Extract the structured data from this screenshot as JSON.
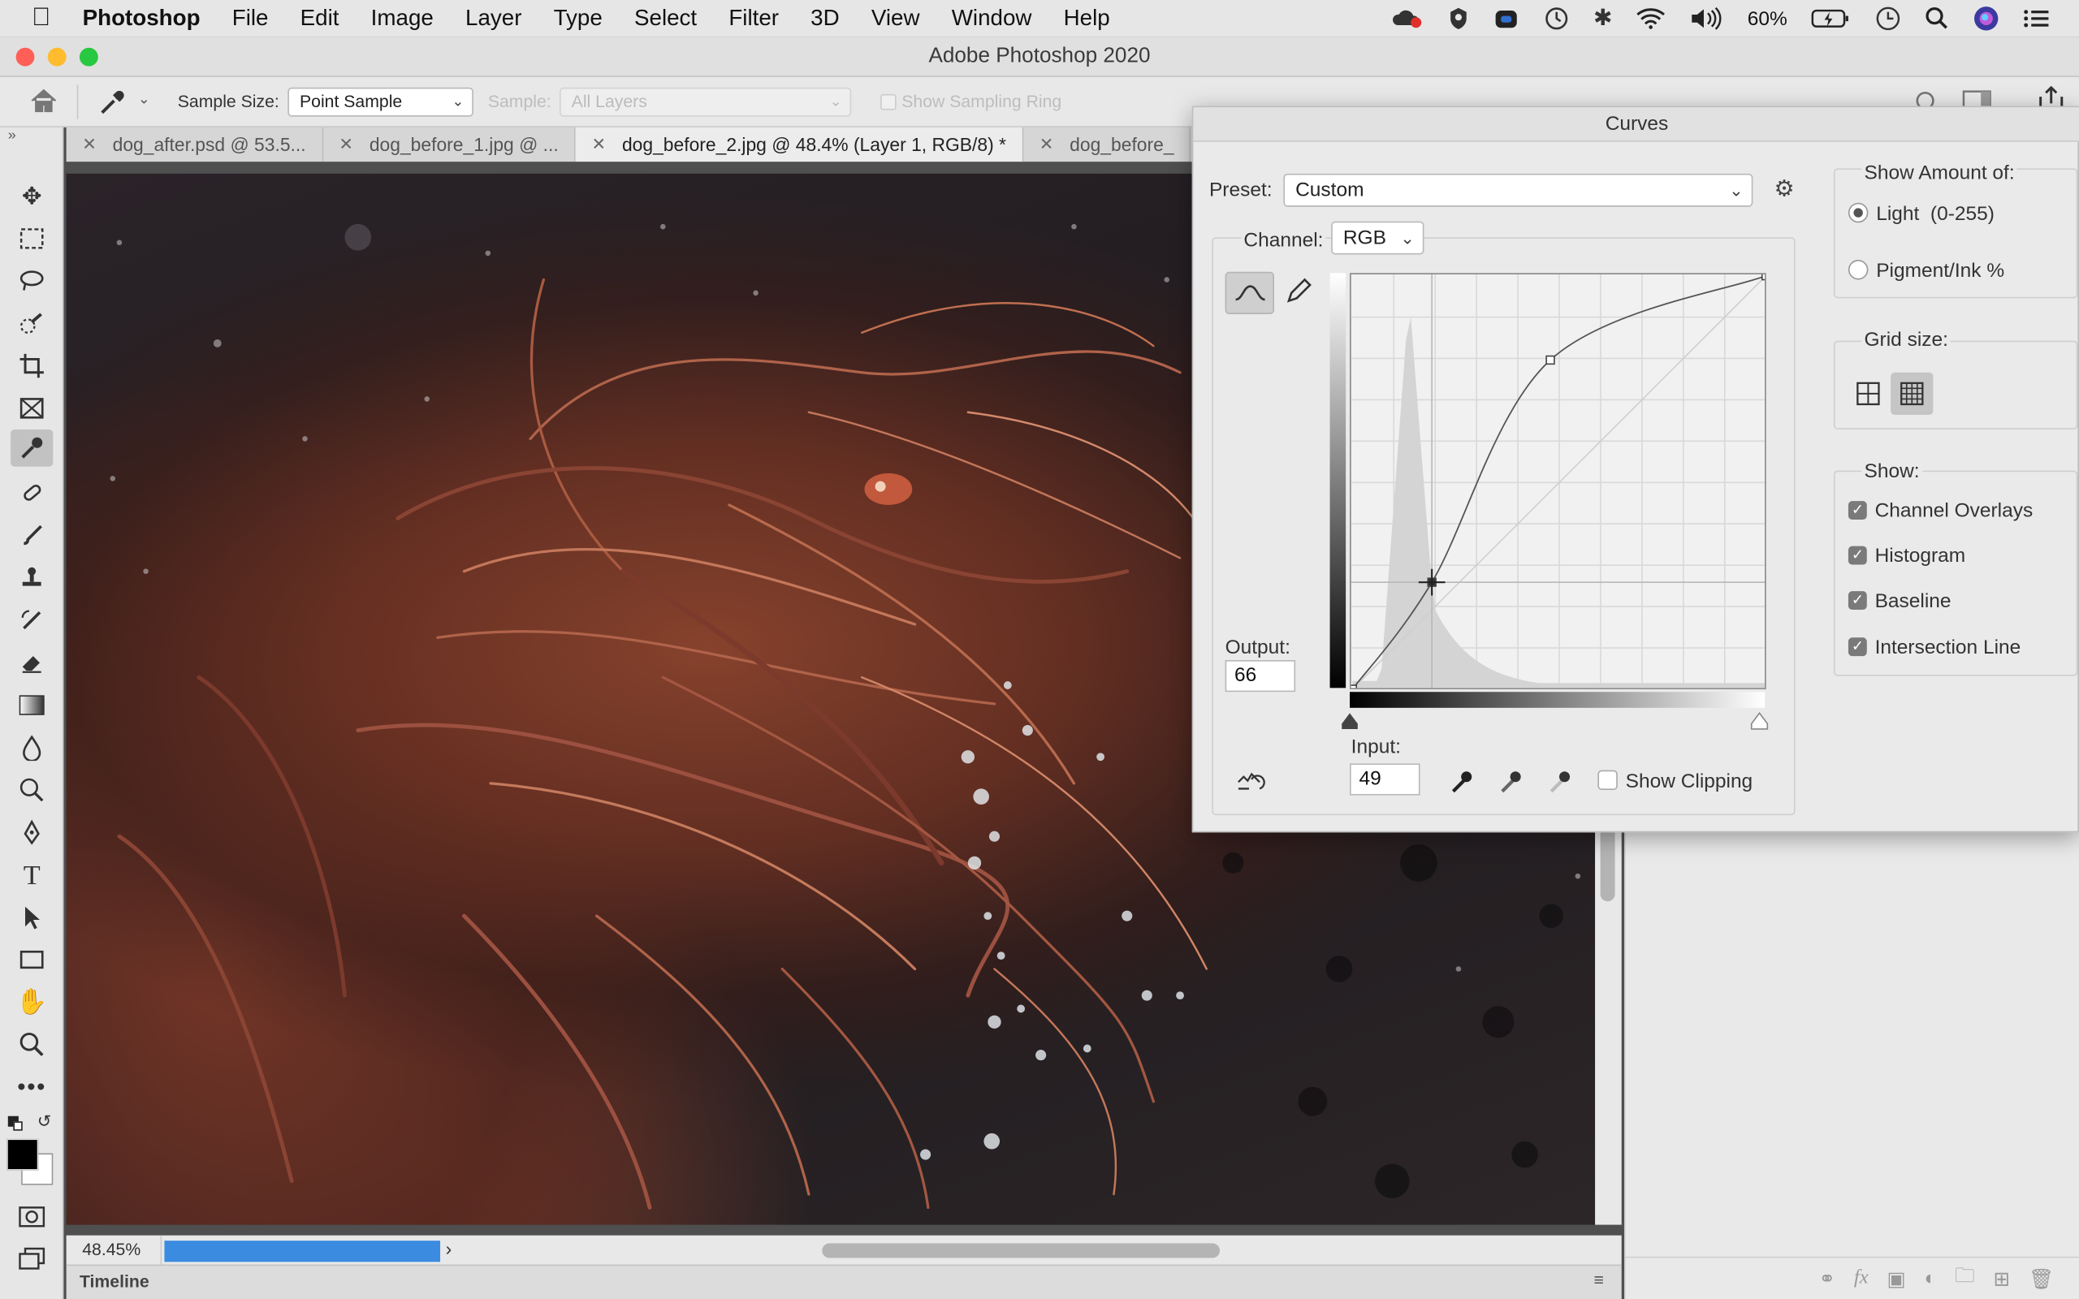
{
  "menubar": {
    "app_name": "Photoshop",
    "items": [
      "File",
      "Edit",
      "Image",
      "Layer",
      "Type",
      "Select",
      "Filter",
      "3D",
      "View",
      "Window",
      "Help"
    ],
    "battery": "60%"
  },
  "window": {
    "title": "Adobe Photoshop 2020"
  },
  "options_bar": {
    "sample_size_label": "Sample Size:",
    "sample_size_value": "Point Sample",
    "sample_label": "Sample:",
    "sample_value": "All Layers",
    "show_sampling_ring": "Show Sampling Ring"
  },
  "tabs": [
    {
      "label": "dog_after.psd @ 53.5..."
    },
    {
      "label": "dog_before_1.jpg @ ..."
    },
    {
      "label": "dog_before_2.jpg @ 48.4% (Layer 1, RGB/8) *"
    },
    {
      "label": "dog_before_"
    }
  ],
  "status": {
    "zoom": "48.45%",
    "timeline": "Timeline"
  },
  "curves": {
    "title": "Curves",
    "preset_label": "Preset:",
    "preset_value": "Custom",
    "channel_label": "Channel:",
    "channel_value": "RGB",
    "output_label": "Output:",
    "output_value": "66",
    "input_label": "Input:",
    "input_value": "49",
    "show_clipping": "Show Clipping",
    "show_amount_label": "Show Amount of:",
    "light_option": "Light  (0-255)",
    "pigment_option": "Pigment/Ink %",
    "grid_size_label": "Grid size:",
    "show_label": "Show:",
    "show_options": [
      "Channel Overlays",
      "Histogram",
      "Baseline",
      "Intersection Line"
    ],
    "curve_points": [
      [
        0,
        0
      ],
      [
        49,
        66
      ],
      [
        122,
        203
      ],
      [
        255,
        255
      ]
    ]
  },
  "colors": {
    "accent": "#3b8be0"
  }
}
